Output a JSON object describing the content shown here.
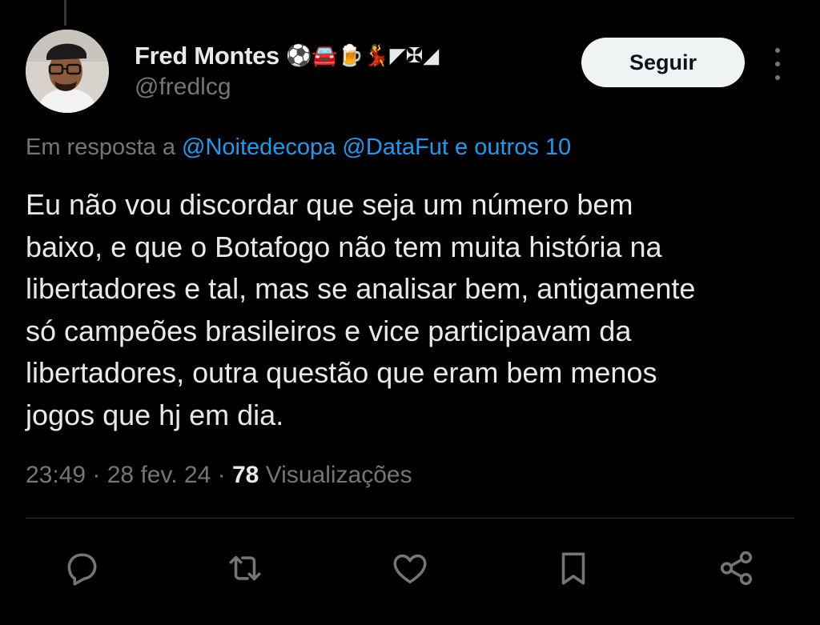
{
  "author": {
    "display_name": "Fred Montes",
    "emojis": "⚽🚘🍺💃◤✠◢",
    "handle": "@fredlcg"
  },
  "follow_button_label": "Seguir",
  "reply_context": {
    "prefix": "Em resposta a ",
    "mention_1": "@Noitedecopa",
    "mention_2": "@DataFut",
    "others": "e outros 10"
  },
  "tweet_lines": [
    "Eu não vou discordar que seja um número bem",
    "baixo, e que o Botafogo não tem muita história na",
    "libertadores e tal, mas se analisar bem, antigamente",
    "só campeões brasileiros e vice participavam da",
    "libertadores, outra questão que eram bem menos",
    "jogos que hj em dia."
  ],
  "meta": {
    "time": "23:49",
    "date": "28 fev. 24",
    "separator": " · ",
    "views_count": "78",
    "views_label": "Visualizações"
  },
  "actions": [
    {
      "icon": "reply-icon"
    },
    {
      "icon": "retweet-icon"
    },
    {
      "icon": "like-icon"
    },
    {
      "icon": "bookmark-icon"
    },
    {
      "icon": "share-icon"
    }
  ],
  "colors": {
    "background": "#000000",
    "text": "#e7e9ea",
    "secondary": "#71767b",
    "link": "#1d9bf0",
    "button_bg": "#eff3f4"
  }
}
